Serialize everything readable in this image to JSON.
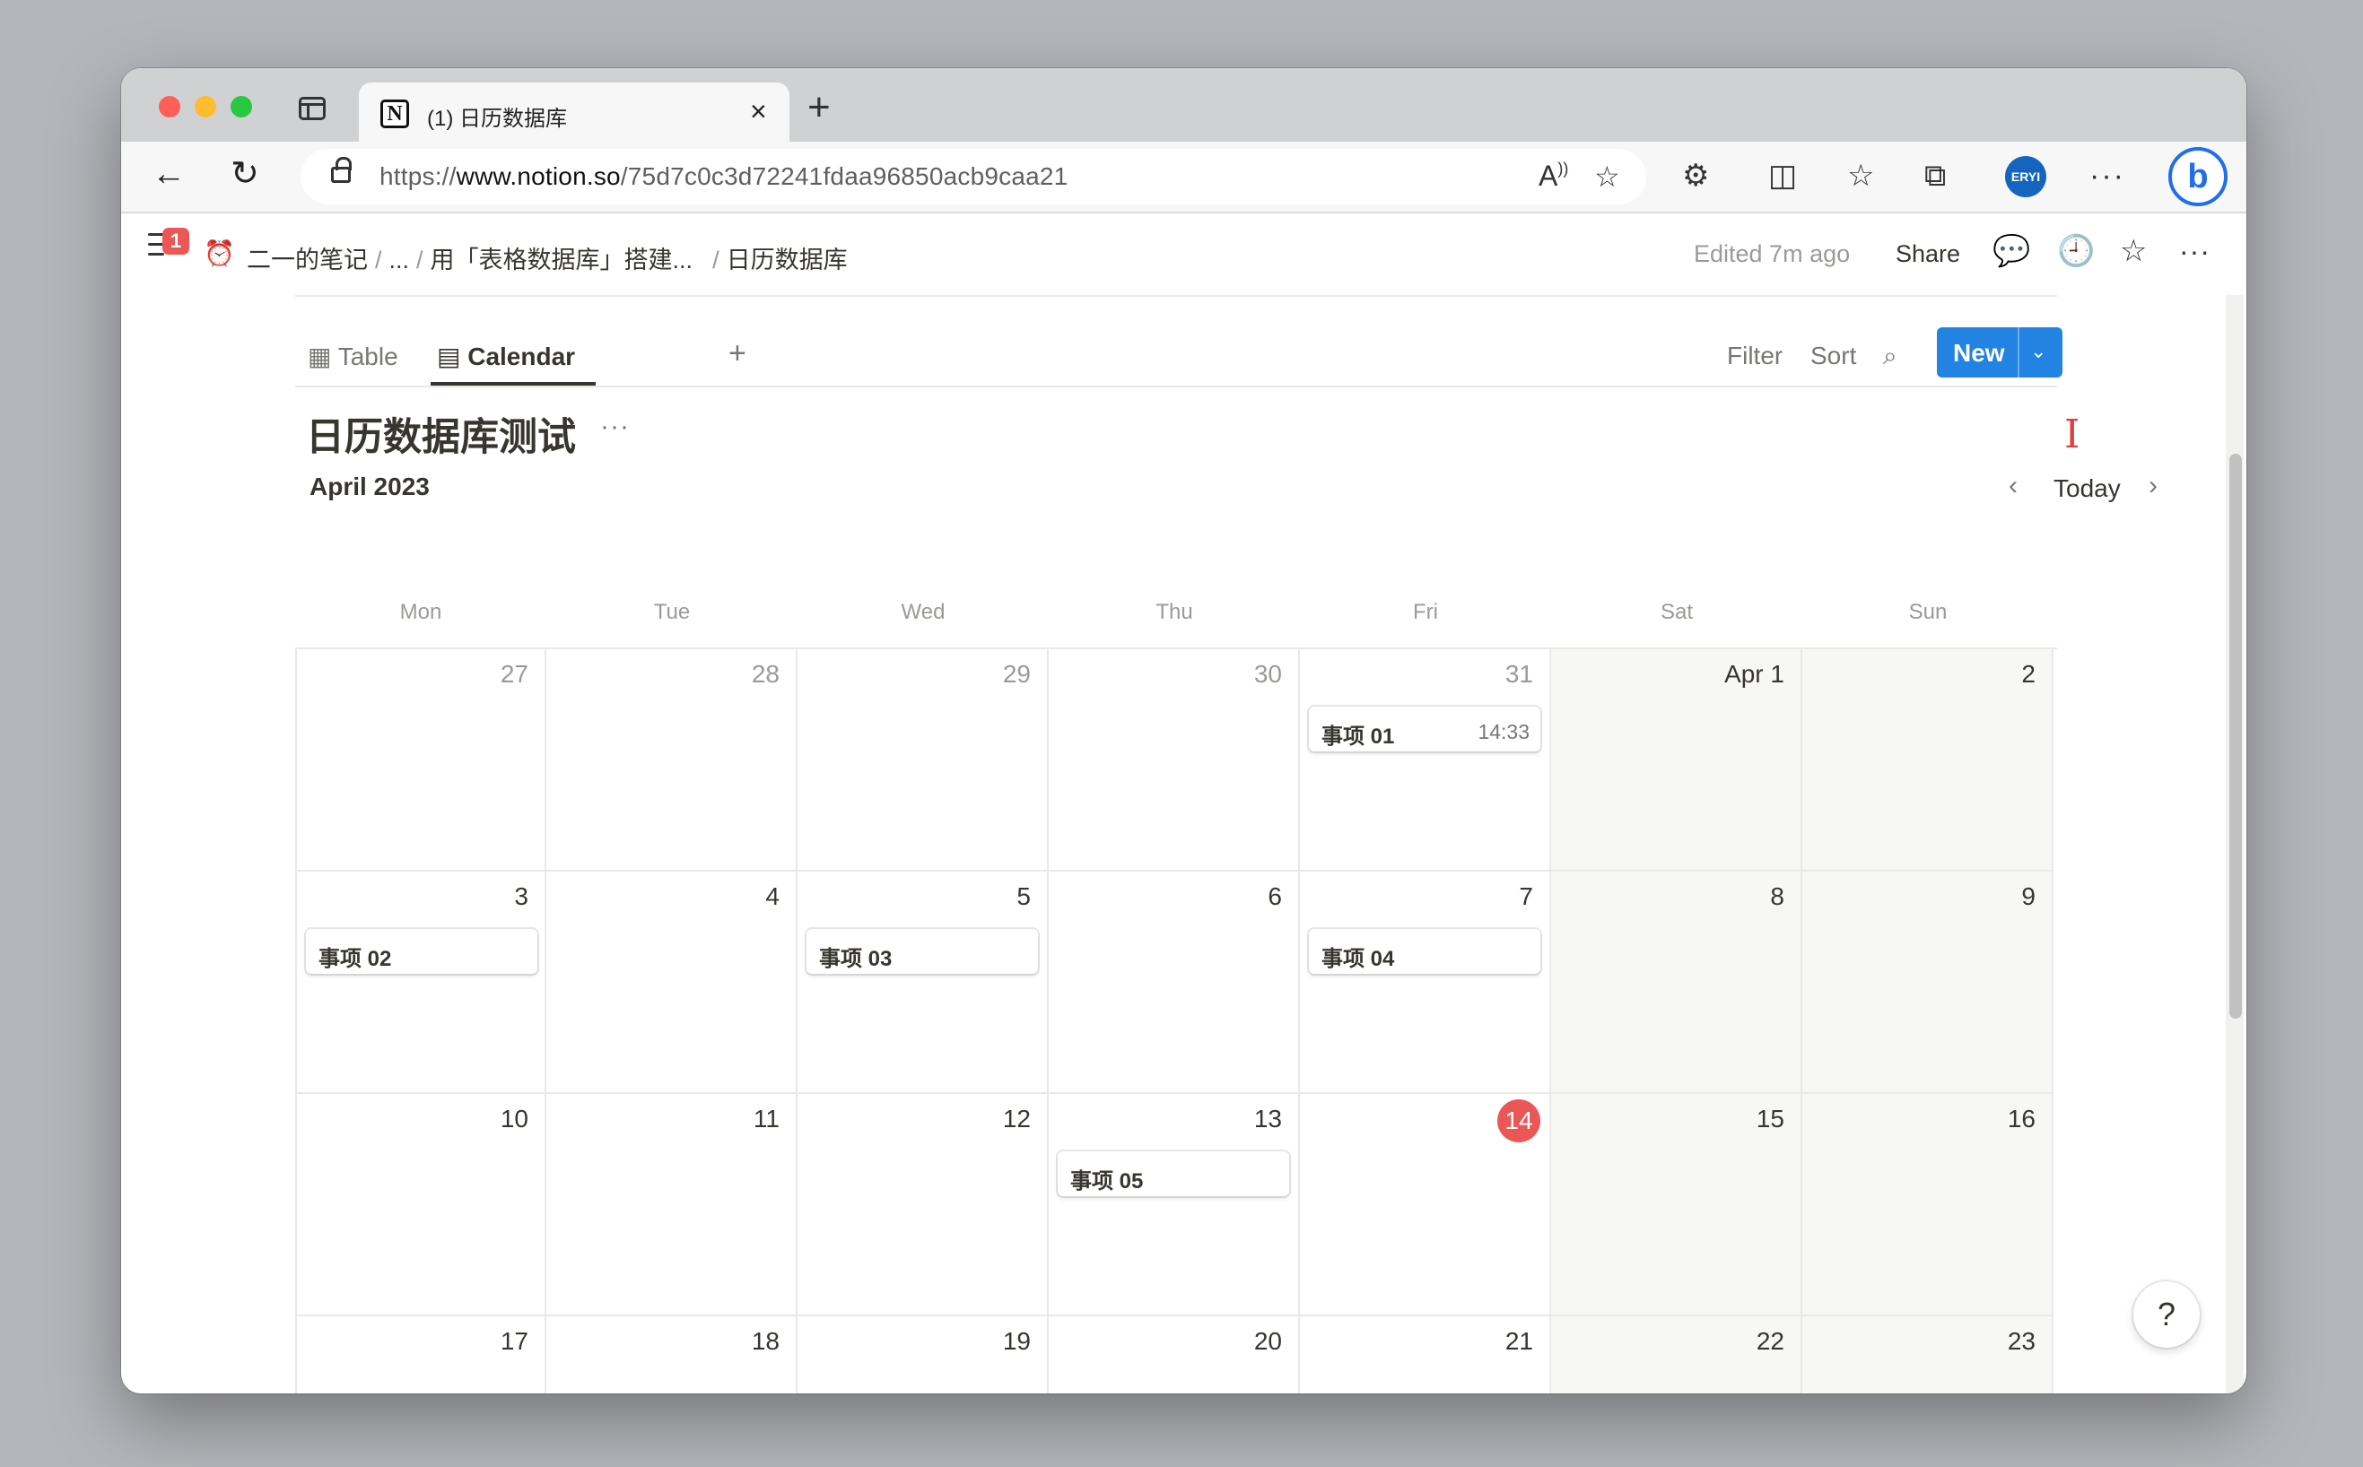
{
  "browser": {
    "tab": {
      "favicon_letter": "N",
      "title": "(1) 日历数据库",
      "close": "×"
    },
    "new_tab": "+",
    "address": {
      "scheme": "https://",
      "host": "www.notion.so",
      "path": "/75d7c0c3d72241fdaa96850acb9caa21"
    },
    "profile_initials": "ERYI",
    "more": "···",
    "bing": "b"
  },
  "header": {
    "notification_count": "1",
    "breadcrumb": [
      "二一的笔记",
      "...",
      "用「表格数据库」搭建...",
      "日历数据库"
    ],
    "separator": "/",
    "edited": "Edited 7m ago",
    "share": "Share"
  },
  "views": {
    "tabs": [
      "Table",
      "Calendar"
    ],
    "add": "+",
    "actions": {
      "filter": "Filter",
      "sort": "Sort",
      "more": "···"
    },
    "new_label": "New"
  },
  "database": {
    "title": "日历数据库测试",
    "more": "···"
  },
  "calendar": {
    "month": "April 2023",
    "today_label": "Today",
    "weekdays": [
      "Mon",
      "Tue",
      "Wed",
      "Thu",
      "Fri",
      "Sat",
      "Sun"
    ],
    "today_date": "14",
    "weeks": [
      [
        "27",
        "28",
        "29",
        "30",
        "31",
        "Apr 1",
        "2"
      ],
      [
        "3",
        "4",
        "5",
        "6",
        "7",
        "8",
        "9"
      ],
      [
        "10",
        "11",
        "12",
        "13",
        "14",
        "15",
        "16"
      ],
      [
        "17",
        "18",
        "19",
        "20",
        "21",
        "22",
        "23"
      ]
    ],
    "events": [
      {
        "title": "事项 01",
        "time": "14:33",
        "week": 0,
        "day": 4
      },
      {
        "title": "事项 02",
        "time": "",
        "week": 1,
        "day": 0
      },
      {
        "title": "事项 03",
        "time": "",
        "week": 1,
        "day": 2
      },
      {
        "title": "事项 04",
        "time": "",
        "week": 1,
        "day": 4
      },
      {
        "title": "事项 05",
        "time": "",
        "week": 2,
        "day": 3
      }
    ]
  },
  "help": "?",
  "colors": {
    "accent": "#2383e2",
    "today": "#eb5757",
    "text": "#37352f",
    "muted": "#9b9a97"
  }
}
